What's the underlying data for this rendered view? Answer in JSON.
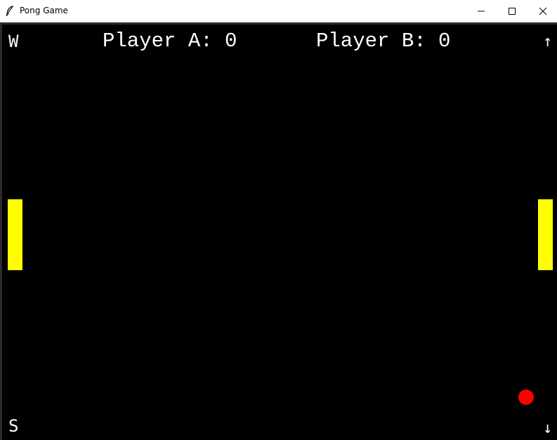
{
  "window": {
    "title": "Pong Game",
    "app_icon": "feather-icon",
    "controls": {
      "minimize_icon": "minimize-icon",
      "maximize_icon": "maximize-icon",
      "close_icon": "close-icon"
    }
  },
  "game": {
    "left_up_key": "W",
    "left_down_key": "S",
    "right_up_key": "↑",
    "right_down_key": "↓",
    "score_a": "Player A: 0",
    "score_b": "Player B: 0",
    "colors": {
      "background": "#000000",
      "text": "#ffffff",
      "paddle": "#ffff00",
      "ball": "#ff0000"
    }
  }
}
